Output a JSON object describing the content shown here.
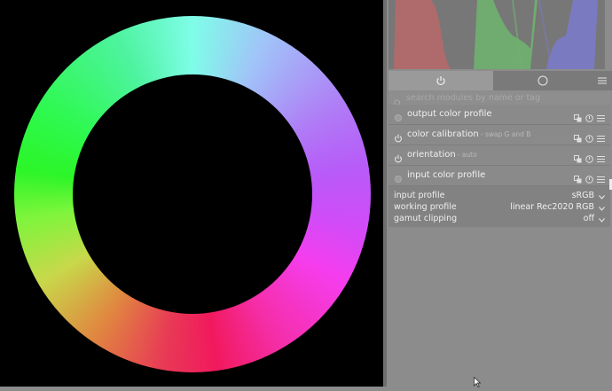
{
  "search": {
    "placeholder": "search modules by name or tag"
  },
  "modules": [
    {
      "name": "output color profile",
      "sub": "",
      "enabled": false
    },
    {
      "name": "color calibration",
      "sub": "- swap G and B",
      "enabled": true
    },
    {
      "name": "orientation",
      "sub": "- auto",
      "enabled": true
    },
    {
      "name": "input color profile",
      "sub": "",
      "enabled": false
    }
  ],
  "params": [
    {
      "label": "input profile",
      "value": "sRGB"
    },
    {
      "label": "working profile",
      "value": "linear Rec2020 RGB"
    },
    {
      "label": "gamut clipping",
      "value": "off"
    }
  ],
  "icons": {
    "tab_active": "power-icon",
    "tab_inactive": "circle-icon",
    "tab_menu": "hamburger-icon",
    "module_actions": [
      "multi-instance-icon",
      "reset-icon",
      "presets-icon"
    ]
  },
  "colors": {
    "panel_bg": "#8c8c8c",
    "image_bg": "#000000",
    "histogram_red": "#e87c7c",
    "histogram_green": "#7ed67e",
    "histogram_blue": "#8c8cf0"
  }
}
